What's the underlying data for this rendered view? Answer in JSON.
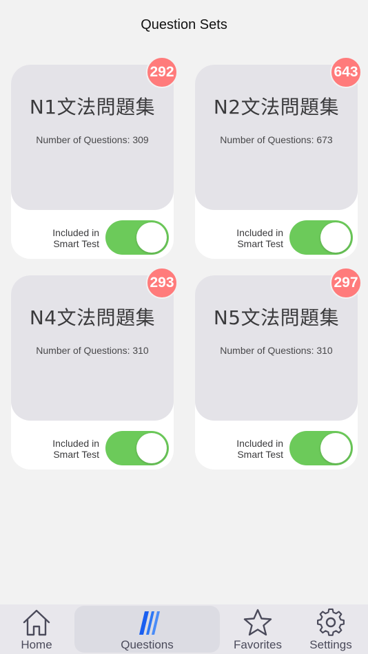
{
  "header": {
    "title": "Question Sets"
  },
  "cards": [
    {
      "title": "N1文法問題集",
      "count": "Number of Questions: 309",
      "badge": "292",
      "toggle_label_1": "Included in",
      "toggle_label_2": "Smart Test",
      "toggle_on": true
    },
    {
      "title": "N2文法問題集",
      "count": "Number of Questions: 673",
      "badge": "643",
      "toggle_label_1": "Included in",
      "toggle_label_2": "Smart Test",
      "toggle_on": true
    },
    {
      "title": "N4文法問題集",
      "count": "Number of Questions: 310",
      "badge": "293",
      "toggle_label_1": "Included in",
      "toggle_label_2": "Smart Test",
      "toggle_on": true
    },
    {
      "title": "N5文法問題集",
      "count": "Number of Questions: 310",
      "badge": "297",
      "toggle_label_1": "Included in",
      "toggle_label_2": "Smart Test",
      "toggle_on": true
    }
  ],
  "tabbar": {
    "tabs": [
      {
        "label": "Home",
        "icon": "home-icon",
        "active": false
      },
      {
        "label": "Questions",
        "icon": "questions-icon",
        "active": true
      },
      {
        "label": "Favorites",
        "icon": "star-icon",
        "active": false
      },
      {
        "label": "Settings",
        "icon": "gear-icon",
        "active": false
      }
    ]
  },
  "colors": {
    "background": "#f2f2f2",
    "card": "#ffffff",
    "card_top": "#e4e3e8",
    "badge": "#ff7b7b",
    "toggle_on": "#6cca5a",
    "tabbar": "#e8e7ec",
    "active_icon": "#1a5ff0"
  }
}
